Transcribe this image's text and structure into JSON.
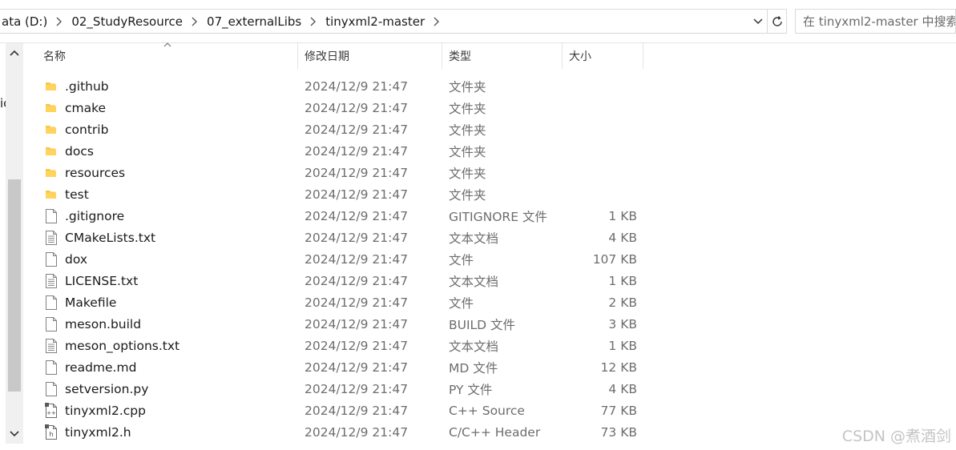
{
  "address": {
    "crumbs": [
      "ata (D:)",
      "02_StudyResource",
      "07_externalLibs",
      "tinyxml2-master"
    ]
  },
  "search": {
    "placeholder": "在 tinyxml2-master 中搜索"
  },
  "nav_fragment": "ic",
  "columns": {
    "name": "名称",
    "date": "修改日期",
    "type": "类型",
    "size": "大小"
  },
  "files": [
    {
      "name": ".github",
      "date": "2024/12/9 21:47",
      "type": "文件夹",
      "size": "",
      "icon": "folder-icon"
    },
    {
      "name": "cmake",
      "date": "2024/12/9 21:47",
      "type": "文件夹",
      "size": "",
      "icon": "folder-icon"
    },
    {
      "name": "contrib",
      "date": "2024/12/9 21:47",
      "type": "文件夹",
      "size": "",
      "icon": "folder-icon"
    },
    {
      "name": "docs",
      "date": "2024/12/9 21:47",
      "type": "文件夹",
      "size": "",
      "icon": "folder-icon"
    },
    {
      "name": "resources",
      "date": "2024/12/9 21:47",
      "type": "文件夹",
      "size": "",
      "icon": "folder-icon"
    },
    {
      "name": "test",
      "date": "2024/12/9 21:47",
      "type": "文件夹",
      "size": "",
      "icon": "folder-icon"
    },
    {
      "name": ".gitignore",
      "date": "2024/12/9 21:47",
      "type": "GITIGNORE 文件",
      "size": "1 KB",
      "icon": "file-icon"
    },
    {
      "name": "CMakeLists.txt",
      "date": "2024/12/9 21:47",
      "type": "文本文档",
      "size": "4 KB",
      "icon": "text-file-icon"
    },
    {
      "name": "dox",
      "date": "2024/12/9 21:47",
      "type": "文件",
      "size": "107 KB",
      "icon": "file-icon"
    },
    {
      "name": "LICENSE.txt",
      "date": "2024/12/9 21:47",
      "type": "文本文档",
      "size": "1 KB",
      "icon": "text-file-icon"
    },
    {
      "name": "Makefile",
      "date": "2024/12/9 21:47",
      "type": "文件",
      "size": "2 KB",
      "icon": "file-icon"
    },
    {
      "name": "meson.build",
      "date": "2024/12/9 21:47",
      "type": "BUILD 文件",
      "size": "3 KB",
      "icon": "file-icon"
    },
    {
      "name": "meson_options.txt",
      "date": "2024/12/9 21:47",
      "type": "文本文档",
      "size": "1 KB",
      "icon": "text-file-icon"
    },
    {
      "name": "readme.md",
      "date": "2024/12/9 21:47",
      "type": "MD 文件",
      "size": "12 KB",
      "icon": "file-icon"
    },
    {
      "name": "setversion.py",
      "date": "2024/12/9 21:47",
      "type": "PY 文件",
      "size": "4 KB",
      "icon": "file-icon"
    },
    {
      "name": "tinyxml2.cpp",
      "date": "2024/12/9 21:47",
      "type": "C++ Source",
      "size": "77 KB",
      "icon": "cpp-source-icon"
    },
    {
      "name": "tinyxml2.h",
      "date": "2024/12/9 21:47",
      "type": "C/C++ Header",
      "size": "73 KB",
      "icon": "c-header-icon"
    }
  ],
  "watermark": "CSDN @煮酒剑"
}
